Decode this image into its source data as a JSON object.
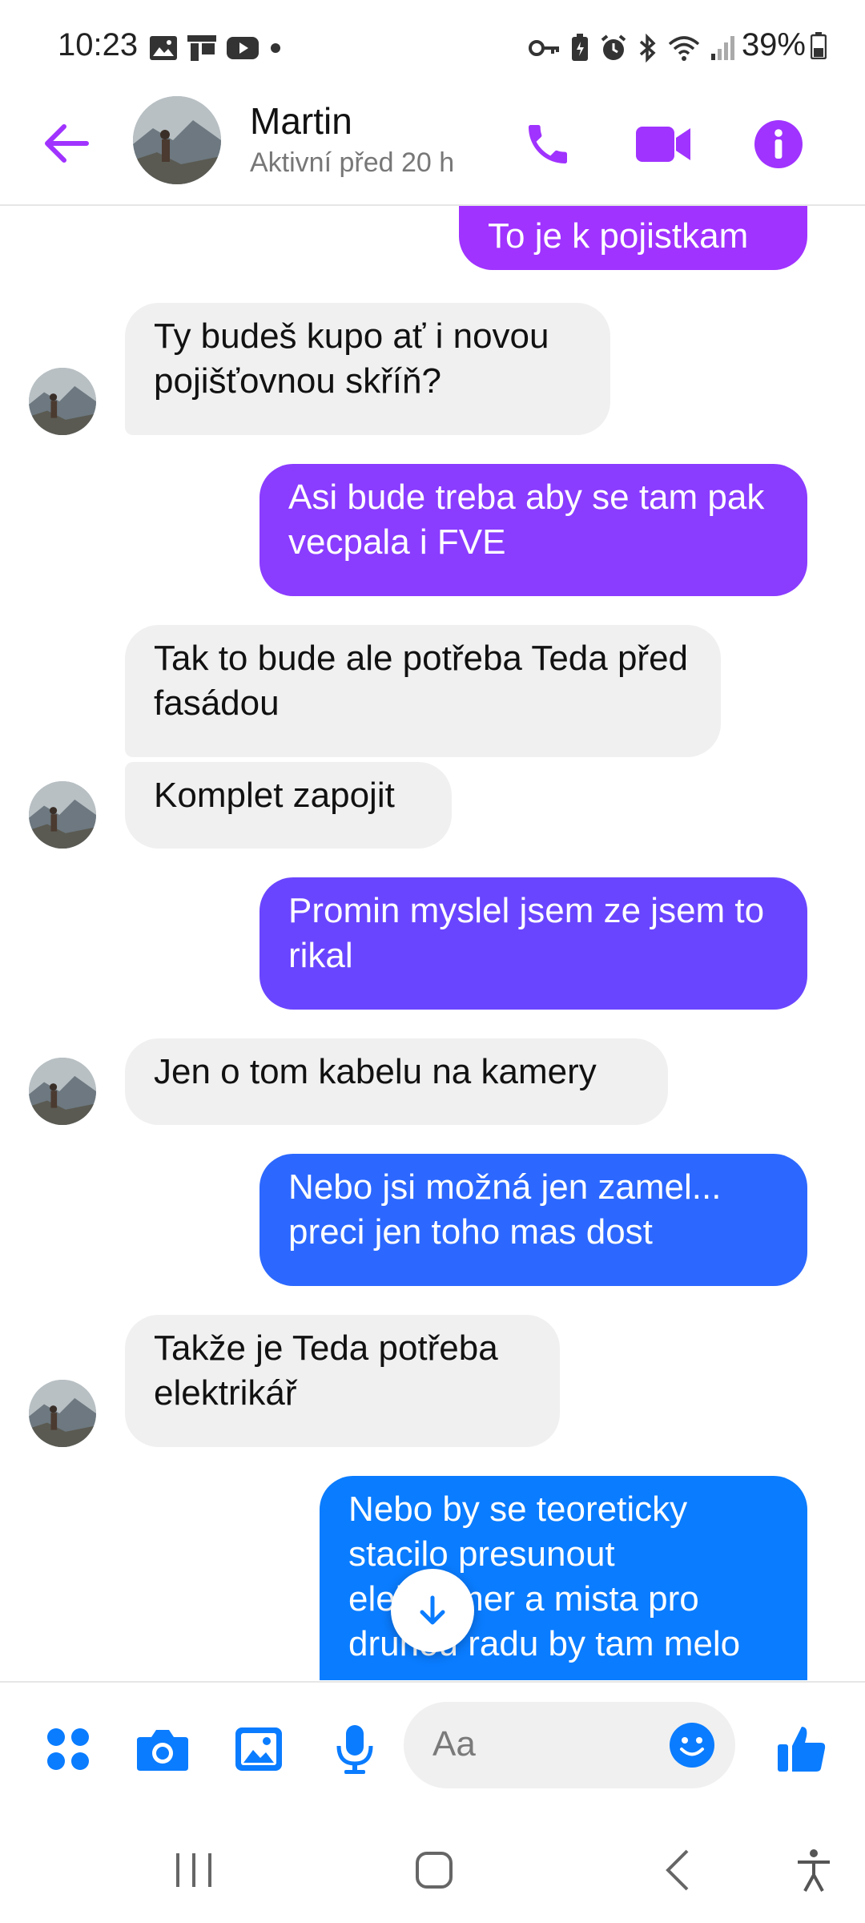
{
  "status_bar": {
    "time": "10:23",
    "battery": "39%",
    "left_icons": [
      "image-icon",
      "cast-icon",
      "youtube-icon",
      "dot-icon"
    ],
    "right_icons": [
      "key-icon",
      "battery-saver-icon",
      "alarm-icon",
      "bluetooth-icon",
      "wifi-icon",
      "signal-icon"
    ]
  },
  "header": {
    "name": "Martin",
    "status": "Aktivní před 20 h",
    "accent": "#a033ff"
  },
  "messages": [
    {
      "from": "me",
      "text": "To je k pojistkam"
    },
    {
      "from": "them",
      "text": "Ty budeš kupo ať i novou pojišťovnou skříň?"
    },
    {
      "from": "me",
      "text": "Asi bude treba aby se tam pak vecpala i FVE"
    },
    {
      "from": "them",
      "text": "Tak to bude ale potřeba Teda před fasádou"
    },
    {
      "from": "them",
      "text": "Komplet zapojit"
    },
    {
      "from": "me",
      "text": "Promin myslel jsem ze jsem to rikal"
    },
    {
      "from": "them",
      "text": "Jen o tom kabelu na kamery"
    },
    {
      "from": "me",
      "text": "Nebo jsi možná jen zamel... preci jen toho mas dost"
    },
    {
      "from": "them",
      "text": "Takže je Teda potřeba elektrikář"
    },
    {
      "from": "me",
      "text": "Nebo by se teoreticky stacilo presunout elektromer a mista pro druhou radu by tam melo"
    }
  ],
  "composer": {
    "placeholder": "Aa",
    "icons": [
      "apps-icon",
      "camera-icon",
      "gallery-icon",
      "microphone-icon",
      "emoji-icon",
      "like-icon"
    ],
    "color": "#0a7cff"
  },
  "nav": {
    "icons": [
      "recents-icon",
      "home-icon",
      "back-icon",
      "accessibility-icon"
    ]
  },
  "colors": {
    "bubble_purple": "#a033ff",
    "bubble_violet": "#6a45ff",
    "bubble_blue": "#2c68ff",
    "bubble_azure": "#0a7cff",
    "bubble_in": "#f0f0f0"
  }
}
